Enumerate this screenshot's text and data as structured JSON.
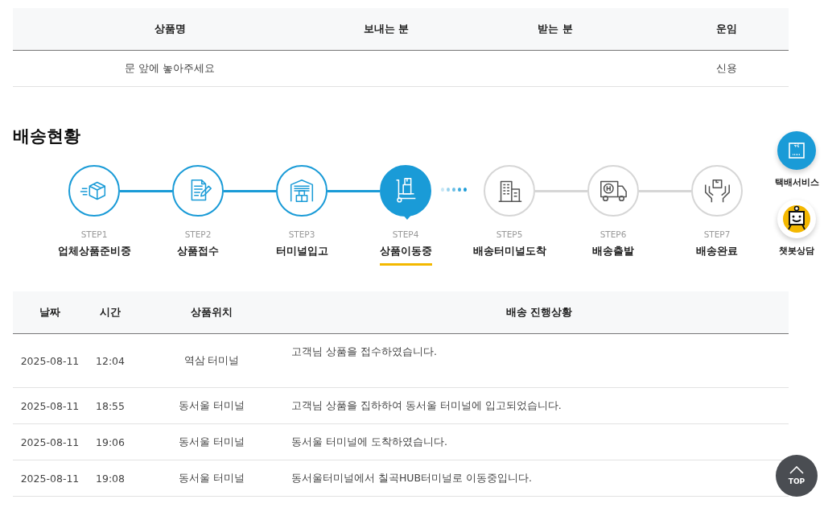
{
  "order_table": {
    "columns": [
      "상품명",
      "보내는 분",
      "받는 분",
      "운임"
    ],
    "row": {
      "product_name": "문 앞에 놓아주세요",
      "fare": "신용"
    }
  },
  "section_title": "배송현황",
  "steps": [
    {
      "step": "STEP1",
      "label": "업체상품준비중",
      "completed": true,
      "selected": false
    },
    {
      "step": "STEP2",
      "label": "상품접수",
      "completed": true,
      "selected": false
    },
    {
      "step": "STEP3",
      "label": "터미널입고",
      "completed": true,
      "selected": false
    },
    {
      "step": "STEP4",
      "label": "상품이동중",
      "completed": false,
      "selected": true
    },
    {
      "step": "STEP5",
      "label": "배송터미널도착",
      "completed": false,
      "selected": false
    },
    {
      "step": "STEP6",
      "label": "배송출발",
      "completed": false,
      "selected": false
    },
    {
      "step": "STEP7",
      "label": "배송완료",
      "completed": false,
      "selected": false
    }
  ],
  "tracking_table": {
    "columns": [
      "날짜",
      "시간",
      "상품위치",
      "배송 진행상황"
    ],
    "rows": [
      {
        "date": "2025-08-11",
        "time": "12:04",
        "location": "역삼 터미널",
        "status": "고객님 상품을 접수하였습니다."
      },
      {
        "date": "2025-08-11",
        "time": "18:55",
        "location": "동서울 터미널",
        "status": "고객님 상품을 집하하여 동서울 터미널에 입고되었습니다."
      },
      {
        "date": "2025-08-11",
        "time": "19:06",
        "location": "동서울 터미널",
        "status": "동서울 터미널에 도착하였습니다."
      },
      {
        "date": "2025-08-11",
        "time": "19:08",
        "location": "동서울 터미널",
        "status": "동서울터미널에서 칠곡HUB터미널로 이동중입니다."
      }
    ]
  },
  "side_menu": [
    {
      "label": "택배서비스"
    },
    {
      "label": "챗봇상담"
    }
  ],
  "top_button": {
    "label": "TOP"
  }
}
